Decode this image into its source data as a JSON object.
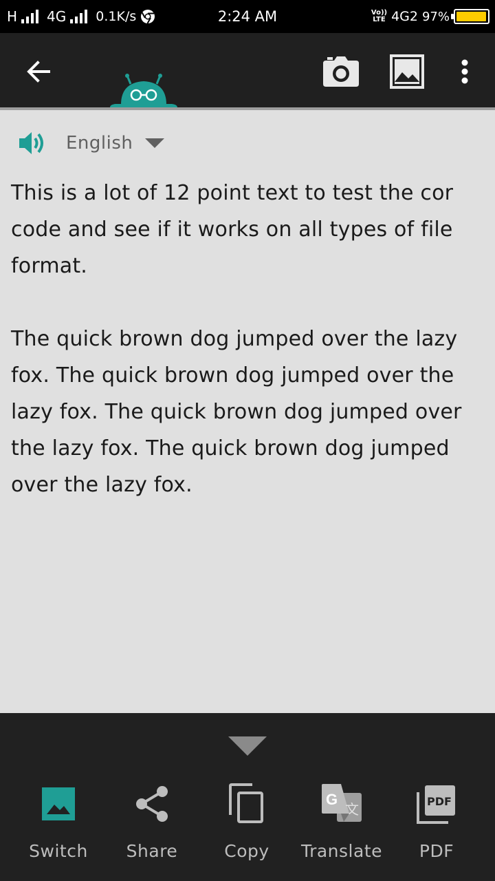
{
  "status_bar": {
    "network_left": "H",
    "network_type": "4G",
    "data_speed": "0.1K/s",
    "time": "2:24 AM",
    "volte_label": "Vo)) LTE",
    "network_right": "4G2",
    "battery_percent": "97%",
    "battery_level": 0.97
  },
  "app_bar": {
    "back_icon": "back-arrow-icon",
    "camera_icon": "camera-icon",
    "gallery_icon": "image-icon",
    "menu_icon": "more-vert-icon"
  },
  "language": {
    "selected": "English",
    "speaker_icon": "speaker-icon"
  },
  "ocr_text": {
    "paragraph1": "This is a lot of 12 point text to test the cor code and see if it works on all types of file format.",
    "paragraph2": "The quick brown dog jumped over the lazy fox. The quick brown dog jumped over the lazy fox. The quick brown dog jumped over the lazy fox. The quick brown dog jumped over the lazy fox."
  },
  "actions": [
    {
      "label": "Switch",
      "icon": "image-icon"
    },
    {
      "label": "Share",
      "icon": "share-icon"
    },
    {
      "label": "Copy",
      "icon": "copy-icon"
    },
    {
      "label": "Translate",
      "icon": "google-translate-icon"
    },
    {
      "label": "PDF",
      "icon": "pdf-icon"
    }
  ],
  "colors": {
    "accent": "#1f9e95",
    "app_bar": "#202020",
    "content_bg": "#e0e0e0",
    "bottom_bar": "#212121",
    "battery": "#ffcc00"
  }
}
